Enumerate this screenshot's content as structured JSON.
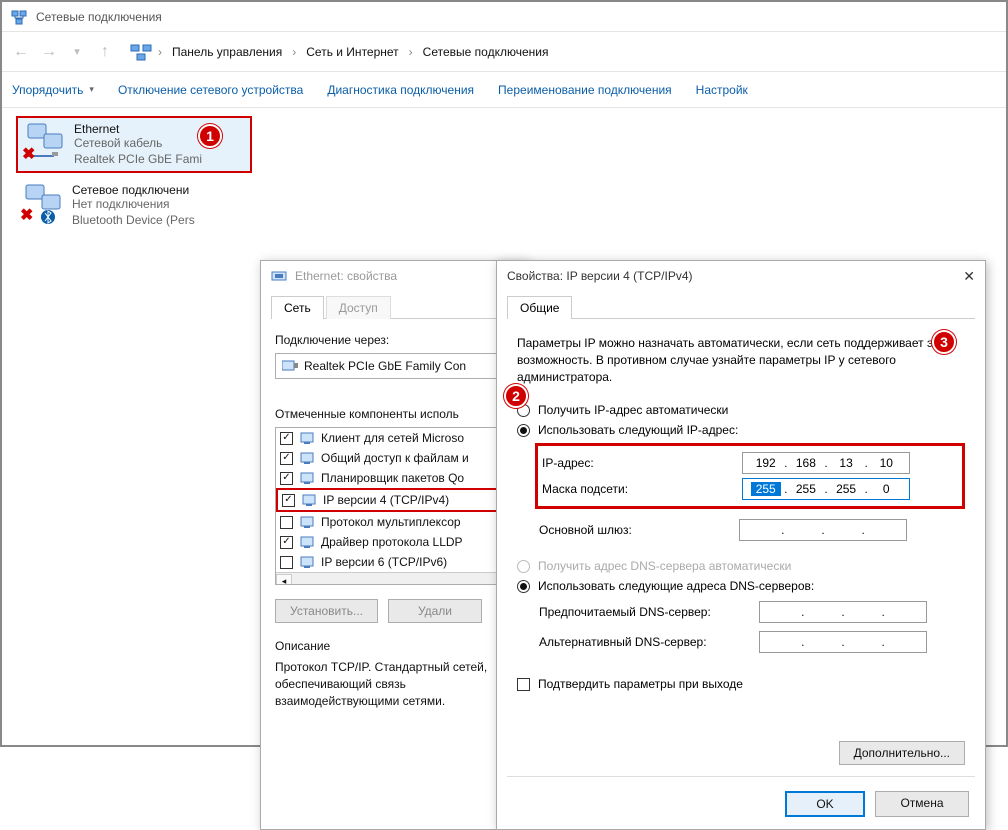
{
  "window": {
    "title": "Сетевые подключения"
  },
  "breadcrumb": {
    "root": "Панель управления",
    "cat": "Сеть и Интернет",
    "leaf": "Сетевые подключения"
  },
  "toolbar": {
    "organize": "Упорядочить",
    "disable": "Отключение сетевого устройства",
    "diag": "Диагностика подключения",
    "rename": "Переименование подключения",
    "settings": "Настройк"
  },
  "connections": [
    {
      "name": "Ethernet",
      "line1": "Сетевой кабель",
      "line2": "Realtek PCIe GbE Fami",
      "error": true
    },
    {
      "name": "Сетевое подключени",
      "line1": "Нет подключения",
      "line2": "Bluetooth Device (Pers",
      "error": true,
      "bt": true
    }
  ],
  "ethDlg": {
    "title": "Ethernet: свойства",
    "tabs": [
      "Сеть",
      "Доступ"
    ],
    "connectVia": "Подключение через:",
    "adapter": "Realtek PCIe GbE Family Con",
    "componentsLabel": "Отмеченные компоненты исполь",
    "components": [
      {
        "checked": true,
        "name": "Клиент для сетей Microso"
      },
      {
        "checked": true,
        "name": "Общий доступ к файлам и"
      },
      {
        "checked": true,
        "name": "Планировщик пакетов Qo"
      },
      {
        "checked": true,
        "name": "IP версии 4 (TCP/IPv4)",
        "highlight": true
      },
      {
        "checked": false,
        "name": "Протокол мультиплексор"
      },
      {
        "checked": true,
        "name": "Драйвер протокола LLDP"
      },
      {
        "checked": false,
        "name": "IP версии 6 (TCP/IPv6)"
      }
    ],
    "install": "Установить...",
    "uninstall": "Удали",
    "descLabel": "Описание",
    "desc": "Протокол TCP/IP. Стандартный сетей, обеспечивающий связь взаимодействующими сетями."
  },
  "ipv4Dlg": {
    "title": "Свойства: IP версии 4 (TCP/IPv4)",
    "tab": "Общие",
    "info": "Параметры IP можно назначать автоматически, если сеть поддерживает эту возможность. В противном случае узнайте параметры IP у сетевого администратора.",
    "autoIp": "Получить IP-адрес автоматически",
    "manualIp": "Использовать следующий IP-адрес:",
    "ipLabel": "IP-адрес:",
    "ip": [
      "192",
      "168",
      "13",
      "10"
    ],
    "maskLabel": "Маска подсети:",
    "mask": [
      "255",
      "255",
      "255",
      "0"
    ],
    "gwLabel": "Основной шлюз:",
    "autoDns": "Получить адрес DNS-сервера автоматически",
    "manualDns": "Использовать следующие адреса DNS-серверов:",
    "dns1Label": "Предпочитаемый DNS-сервер:",
    "dns2Label": "Альтернативный DNS-сервер:",
    "confirmExit": "Подтвердить параметры при выходе",
    "advanced": "Дополнительно...",
    "ok": "OK",
    "cancel": "Отмена"
  },
  "steps": {
    "1": "1",
    "2": "2",
    "3": "3"
  }
}
